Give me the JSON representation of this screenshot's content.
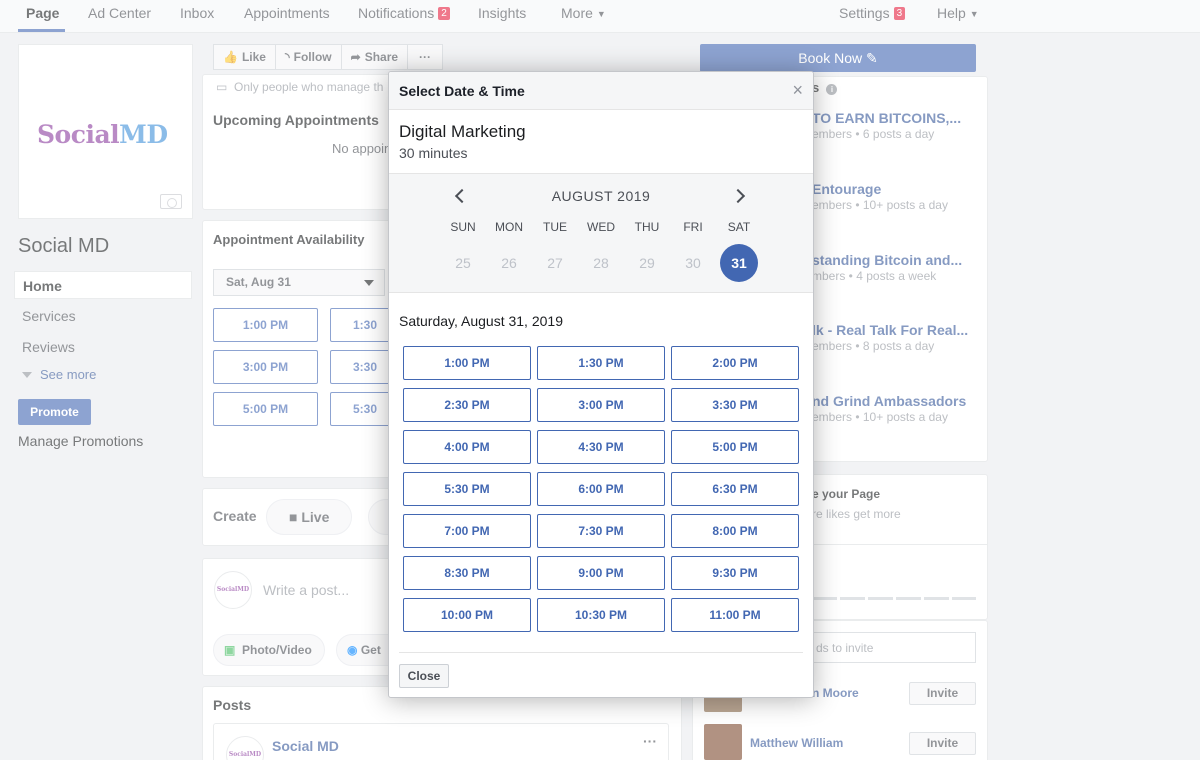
{
  "nav": {
    "page": "Page",
    "ad_center": "Ad Center",
    "inbox": "Inbox",
    "appointments": "Appointments",
    "notifications": "Notifications",
    "notifications_count": "2",
    "insights": "Insights",
    "more": "More",
    "settings": "Settings",
    "settings_count": "3",
    "help": "Help"
  },
  "sidebar": {
    "logo_part1": "Social",
    "logo_part2": "MD",
    "page_name": "Social MD",
    "items": [
      "Home",
      "Services",
      "Reviews"
    ],
    "see_more": "See more",
    "promote": "Promote",
    "manage_promotions": "Manage Promotions"
  },
  "page_actions": {
    "like": "Like",
    "follow": "Follow",
    "share": "Share",
    "more": "···"
  },
  "main": {
    "notice": "Only people who manage th",
    "upcoming_title": "Upcoming Appointments",
    "upcoming_empty": "No appoin",
    "availability_title": "Appointment Availability",
    "date_select": "Sat, Aug 31",
    "slots": [
      "1:00 PM",
      "1:30",
      "3:00 PM",
      "3:30",
      "5:00 PM",
      "5:30"
    ],
    "create_label": "Create",
    "live": "Live",
    "write_post": "Write a post...",
    "photo_video": "Photo/Video",
    "get": "Get",
    "posts_title": "Posts",
    "post_author": "Social MD",
    "post_more": "···",
    "avatar_text": "SocialMD"
  },
  "right": {
    "book_now": "Book Now",
    "groups_header_tail": "s",
    "groups": [
      {
        "name": "TO EARN BITCOINS,...",
        "meta": "embers • 6 posts a day"
      },
      {
        "name": "Entourage",
        "meta": "embers • 10+ posts a day"
      },
      {
        "name": "standing Bitcoin and...",
        "meta": "mbers • 4 posts a week"
      },
      {
        "name": "lk - Real Talk For Real...",
        "meta": "embers • 8 posts a day"
      },
      {
        "name": "nd Grind Ambassadors",
        "meta": "embers • 10+ posts a day"
      }
    ],
    "promote_title": "e your Page",
    "promote_sub": "re likes get more",
    "invite_placeholder": "ds to invite",
    "friends": [
      {
        "name": "n Moore",
        "invite": "Invite"
      },
      {
        "name": "Matthew William",
        "invite": "Invite"
      }
    ]
  },
  "modal": {
    "title": "Select Date & Time",
    "close_x": "×",
    "service_name": "Digital Marketing",
    "duration": "30 minutes",
    "month": "AUGUST 2019",
    "weekdays": [
      "SUN",
      "MON",
      "TUE",
      "WED",
      "THU",
      "FRI",
      "SAT"
    ],
    "days": [
      "25",
      "26",
      "27",
      "28",
      "29",
      "30",
      "31"
    ],
    "selected_date": "Saturday, August 31, 2019",
    "slots": [
      "1:00 PM",
      "1:30 PM",
      "2:00 PM",
      "2:30 PM",
      "3:00 PM",
      "3:30 PM",
      "4:00 PM",
      "4:30 PM",
      "5:00 PM",
      "5:30 PM",
      "6:00 PM",
      "6:30 PM",
      "7:00 PM",
      "7:30 PM",
      "8:00 PM",
      "8:30 PM",
      "9:00 PM",
      "9:30 PM",
      "10:00 PM",
      "10:30 PM",
      "11:00 PM"
    ],
    "close_button": "Close"
  },
  "colors": {
    "brand_blue": "#4267b2",
    "link_blue": "#365899",
    "badge_red": "#e41e3f"
  }
}
